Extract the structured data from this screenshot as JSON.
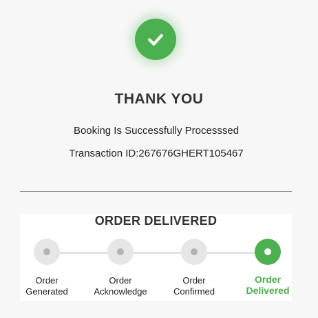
{
  "header": {
    "title": "THANK YOU",
    "message": "Booking Is Successfully Processsed",
    "transaction": "Transaction ID:267676GHERT105467"
  },
  "tracker": {
    "title": "ORDER DELIVERED",
    "steps": [
      {
        "line1": "Order",
        "line2": "Generated",
        "active": false
      },
      {
        "line1": "Order",
        "line2": "Acknowledge",
        "active": false
      },
      {
        "line1": "Order",
        "line2": "Confirmed",
        "active": false
      },
      {
        "line1": "Order",
        "line2": "Delivered",
        "active": true
      }
    ]
  },
  "colors": {
    "accent": "#4caf50",
    "inactive_dot": "#e6e6e6",
    "inactive_inner": "#b3b3b3",
    "background": "#f7f7f7"
  },
  "icons": {
    "success": "checkmark-icon",
    "step_dot": "dot-icon"
  }
}
